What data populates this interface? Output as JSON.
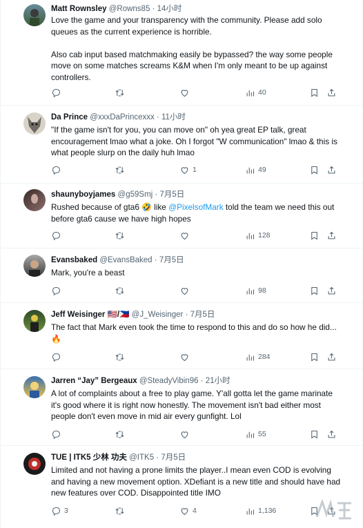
{
  "tweets": [
    {
      "name": "Matt Rownsley",
      "handle": "@Rowns85",
      "time": "14小时",
      "text": "Love the game and your transparency with the community. Please add solo queues as the current experience is horrible.\n\nAlso cab input based matchmaking easily be bypassed? the way some people move on some matches screams K&M when I'm only meant to be up against controllers.",
      "replies": "",
      "likes": "",
      "views": "40"
    },
    {
      "name": "Da Prince",
      "handle": "@xxxDaPrincexxx",
      "time": "11小时",
      "text": "\"If the game isn't for you, you can move on\" oh yea great EP talk, great encouragement lmao what a joke. Oh I forgot \"W communication\" lmao & this is what people slurp on the daily huh lmao",
      "replies": "",
      "likes": "1",
      "views": "49"
    },
    {
      "name": "shaunyboyjames",
      "handle": "@g59Smj",
      "time": "7月5日",
      "text_before": "Rushed because of gta6 🤣 like ",
      "mention": "@PixelsofMark",
      "text_after": " told the team we need this out before gta6 cause we have high hopes",
      "replies": "",
      "likes": "",
      "views": "128"
    },
    {
      "name": "Evansbaked",
      "handle": "@EvansBaked",
      "time": "7月5日",
      "text": "Mark, you're a beast",
      "replies": "",
      "likes": "",
      "views": "98"
    },
    {
      "name": "Jeff Weisinger 🇺🇸/🇵🇭",
      "handle": "@J_Weisinger",
      "time": "7月5日",
      "text": "The fact that Mark even took the time to respond to this and do so how he did... 🔥",
      "replies": "",
      "likes": "",
      "views": "284"
    },
    {
      "name": "Jarren “Jay” Bergeaux",
      "handle": "@SteadyVibin96",
      "time": "21小时",
      "text": "A lot of complaints about a free to play game. Y'all gotta let the game marinate it's good where it is right now honestly. The movement isn't bad either most people don't even move in mid air every gunfight. Lol",
      "replies": "",
      "likes": "",
      "views": "55"
    },
    {
      "name": "TUE | ITK5 少林 功夫",
      "handle": "@ITK5",
      "time": "7月5日",
      "text": "Limited and not having a prone limits the player..I mean even COD is evolving and having a new movement option. XDefiant is a new title and should have had new features over COD. Disappointed title IMO",
      "replies": "3",
      "likes": "4",
      "views": "1,136"
    }
  ],
  "dot": "·",
  "icons": [
    "reply-icon",
    "retweet-icon",
    "like-icon",
    "views-icon",
    "bookmark-icon",
    "share-icon"
  ]
}
